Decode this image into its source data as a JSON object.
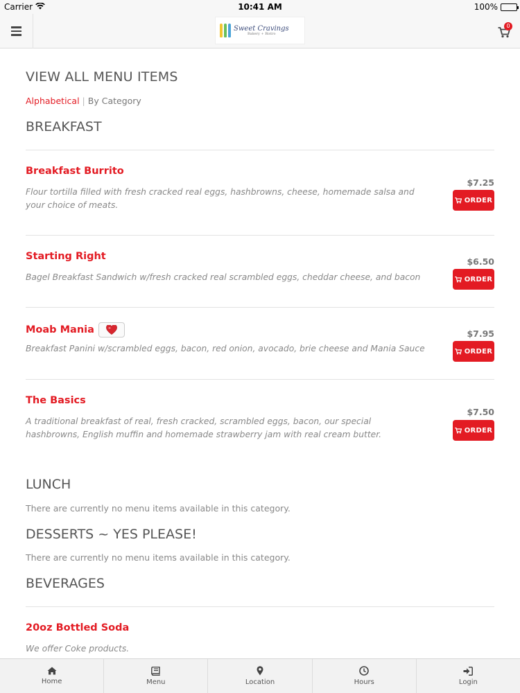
{
  "status_bar": {
    "carrier": "Carrier",
    "time": "10:41 AM",
    "battery": "100%"
  },
  "header": {
    "logo_name": "Sweet Cravings",
    "logo_subtitle": "Bakery + Bistro",
    "cart_count": "0"
  },
  "page": {
    "title": "VIEW ALL MENU ITEMS",
    "sort_alphabetical": "Alphabetical",
    "sort_separator": "|",
    "sort_by_category": "By Category"
  },
  "categories": {
    "breakfast": {
      "title": "BREAKFAST",
      "items": [
        {
          "name": "Breakfast Burrito",
          "description": "Flour tortilla filled with fresh cracked real eggs, hashbrowns, cheese, homemade salsa and your choice of meats.",
          "price": "$7.25",
          "order_label": "ORDER"
        },
        {
          "name": "Starting Right",
          "description": "Bagel Breakfast Sandwich w/fresh cracked real scrambled eggs, cheddar cheese, and bacon",
          "price": "$6.50",
          "order_label": "ORDER"
        },
        {
          "name": "Moab Mania",
          "description": "Breakfast Panini w/scrambled eggs, bacon, red onion, avocado, brie cheese and Mania Sauce",
          "price": "$7.95",
          "order_label": "ORDER",
          "badge_icon": "heart-icon"
        },
        {
          "name": "The Basics",
          "description": "A traditional breakfast of real, fresh cracked, scrambled eggs, bacon, our special hashbrowns, English muffin and homemade strawberry jam with real cream butter.",
          "price": "$7.50",
          "order_label": "ORDER"
        }
      ]
    },
    "lunch": {
      "title": "LUNCH",
      "empty_message": "There are currently no menu items available in this category."
    },
    "desserts": {
      "title": "DESSERTS ~ YES PLEASE!",
      "empty_message": "There are currently no menu items available in this category."
    },
    "beverages": {
      "title": "BEVERAGES",
      "items": [
        {
          "name": "20oz Bottled Soda",
          "description": "We offer Coke products."
        }
      ]
    }
  },
  "tab_bar": {
    "tabs": [
      {
        "label": "Home",
        "icon": "home-icon"
      },
      {
        "label": "Menu",
        "icon": "book-icon"
      },
      {
        "label": "Location",
        "icon": "map-marker-icon"
      },
      {
        "label": "Hours",
        "icon": "clock-icon"
      },
      {
        "label": "Login",
        "icon": "sign-in-icon"
      }
    ]
  },
  "colors": {
    "accent": "#e31b23",
    "header_bg": "#f7f7f7",
    "text_muted": "#888888"
  }
}
